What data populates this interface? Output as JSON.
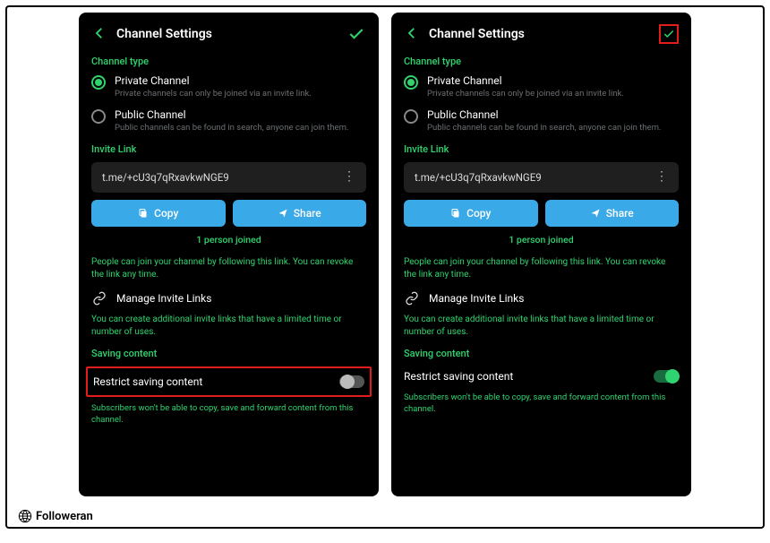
{
  "header": {
    "title": "Channel Settings"
  },
  "channel_type": {
    "section_label": "Channel type",
    "private": {
      "title": "Private Channel",
      "desc": "Private channels can only be joined via an invite link."
    },
    "public": {
      "title": "Public Channel",
      "desc": "Public channels can be found in search, anyone can join them."
    }
  },
  "invite": {
    "section_label": "Invite Link",
    "link": "t.me/+cU3q7qRxavkwNGE9",
    "copy": "Copy",
    "share": "Share",
    "joined": "1 person joined",
    "desc": "People can join your channel by following this link. You can revoke the link any time.",
    "manage": "Manage Invite Links",
    "manage_desc": "You can create additional invite links that have a limited time or number of uses."
  },
  "saving": {
    "section_label": "Saving content",
    "restrict": "Restrict saving content",
    "desc": "Subscribers won't be able to copy, save and forward content from this channel."
  },
  "watermark": "Followeran"
}
